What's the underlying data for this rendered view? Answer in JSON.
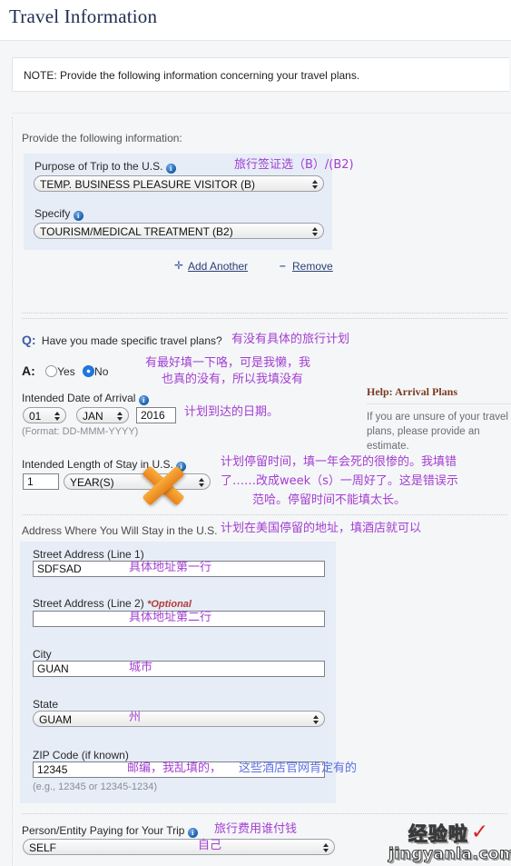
{
  "page": {
    "title": "Travel Information",
    "note": "NOTE: Provide the following information concerning your travel plans."
  },
  "purpose_section": {
    "intro": "Provide the following information:",
    "purpose_label": "Purpose of Trip to the U.S.",
    "purpose_value": "TEMP. BUSINESS PLEASURE VISITOR (B)",
    "purpose_annotation": "旅行签证选（B）/(B2)",
    "specify_label": "Specify",
    "specify_value": "TOURISM/MEDICAL TREATMENT (B2)",
    "add_another_label": "Add Another",
    "add_another_icon": "plus-icon",
    "remove_label": "Remove",
    "remove_icon": "minus-icon",
    "info_icon": "info-icon"
  },
  "travel_plans": {
    "q_prefix": "Q:",
    "question": "Have you made specific travel plans?",
    "question_annotation": "有没有具体的旅行计划",
    "a_prefix": "A:",
    "yes_label": "Yes",
    "no_label": "No",
    "selected": "No",
    "answer_annotation_line1": "有最好填一下咯，可是我懒，我",
    "answer_annotation_line2": "也真的没有，所以我填没有"
  },
  "arrival": {
    "label": "Intended Date of Arrival",
    "day": "01",
    "month": "JAN",
    "year": "2016",
    "format_hint": "(Format: DD-MMM-YYYY)",
    "annotation": "计划到达的日期。"
  },
  "help": {
    "title": "Help: Arrival Plans",
    "body": "If you are unsure of your travel plans, please provide an estimate."
  },
  "length_of_stay": {
    "label": "Intended Length of Stay in U.S.",
    "value": "1",
    "unit": "YEAR(S)",
    "annotation_line1": "计划停留时间，填一年会死的很惨的。我填错",
    "annotation_line2": "了……改成week（s）一周好了。这是错误示",
    "annotation_line3": "范哈。停留时间不能填太长。",
    "marker_icon": "orange-x-marker"
  },
  "address": {
    "section_label": "Address Where You Will Stay in the U.S.",
    "section_annotation": "计划在美国停留的地址，填酒店就可以",
    "line1_label": "Street Address (Line 1)",
    "line1_value": "SDFSAD",
    "line1_annotation": "具体地址第一行",
    "line2_label": "Street Address (Line 2)",
    "line2_optional": "*Optional",
    "line2_value": "",
    "line2_annotation": "具体地址第二行",
    "city_label": "City",
    "city_value": "GUAN",
    "city_annotation": "城市",
    "state_label": "State",
    "state_value": "GUAM",
    "state_annotation": "州",
    "zip_label": "ZIP Code (if known)",
    "zip_value": "12345",
    "zip_hint": "(e.g., 12345 or 12345-1234)",
    "zip_annotation": "邮编，我乱填的，",
    "zip_annotation_blue": "这些酒店官网肯定有的"
  },
  "payer": {
    "label": "Person/Entity Paying for Your Trip",
    "value": "SELF",
    "annotation": "旅行费用谁付钱",
    "value_annotation": "自己"
  },
  "watermark": {
    "cn": "经验啦",
    "check": "✓",
    "domain": "jingyanla.com"
  },
  "colors": {
    "title": "#1e2d52",
    "annotation_purple": "#a23fd0",
    "annotation_blue": "#5b6fe0",
    "panel_blue": "#e6edf7",
    "page_bg": "#f5f6f8",
    "help_title": "#7a3a22",
    "radio_on": "#1f78e0"
  }
}
